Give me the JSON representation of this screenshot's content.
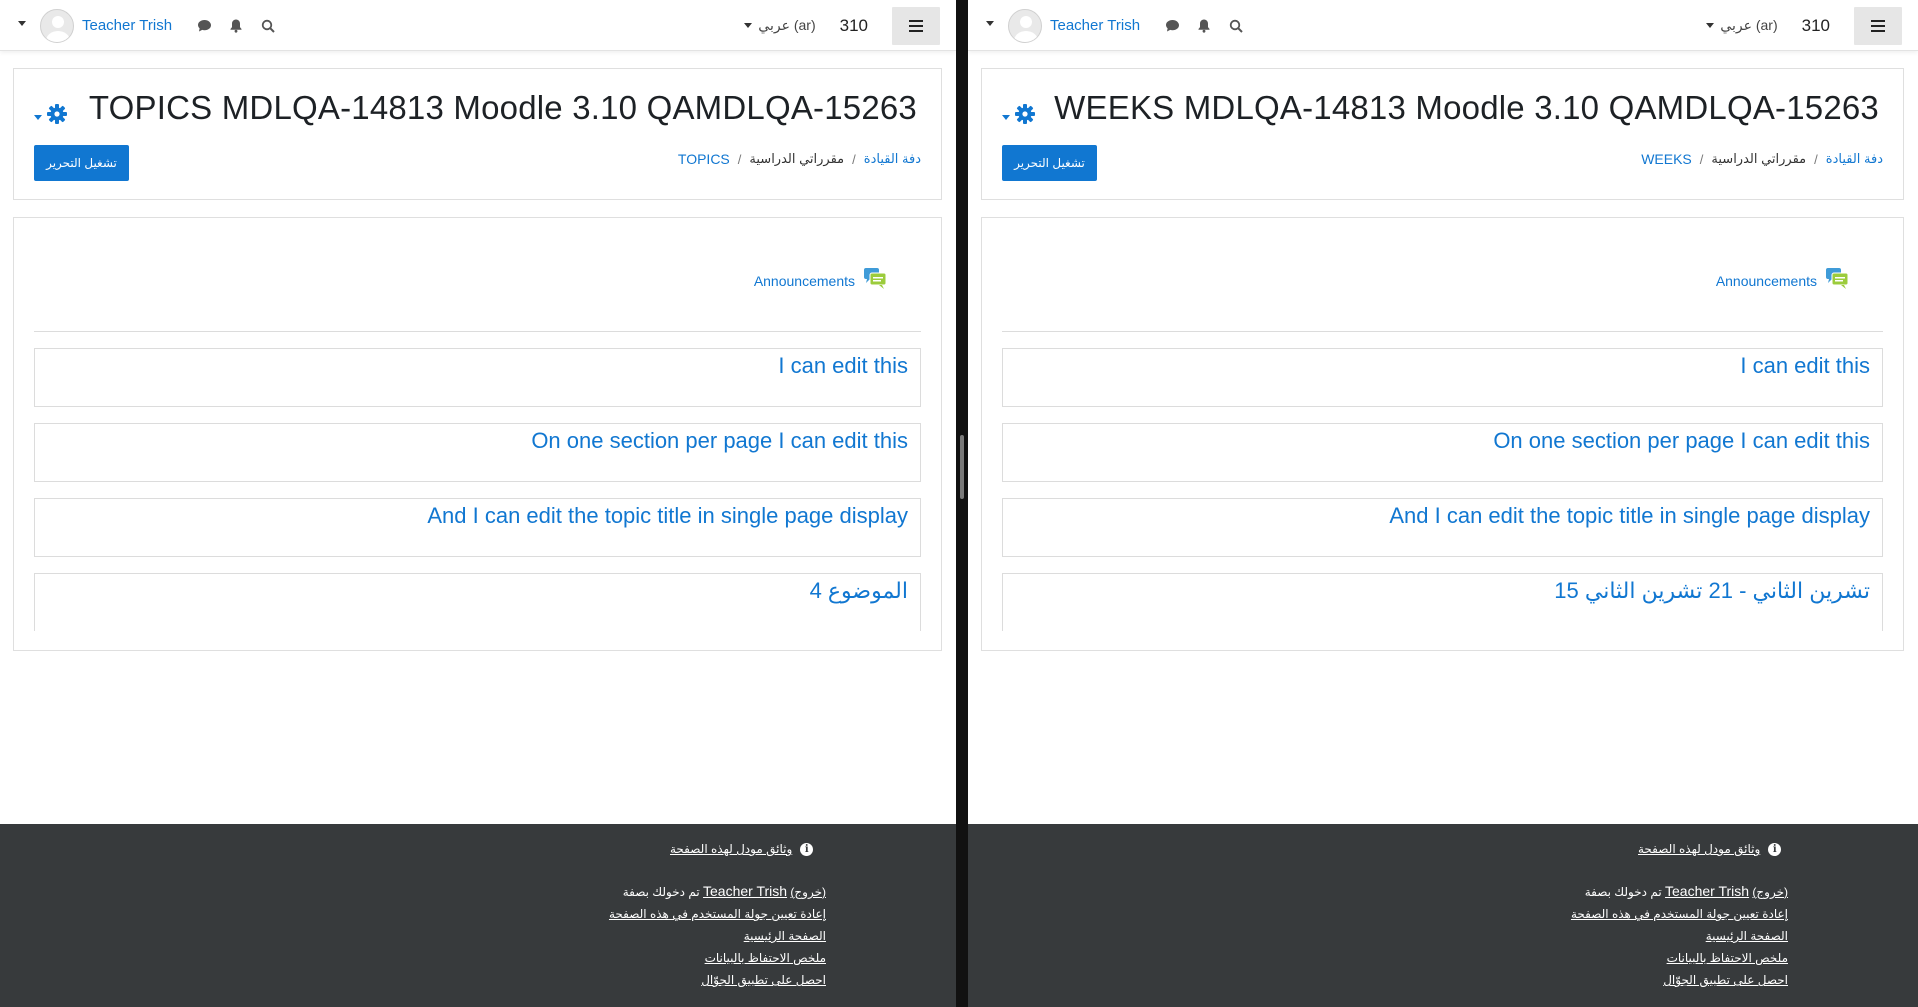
{
  "panes": {
    "left": {
      "navbar": {
        "user_name": "Teacher Trish",
        "lang_label": "عربي ‎(ar)‎",
        "points": "310"
      },
      "header": {
        "title": "TOPICS MDLQA-14813 Moodle 3.10 QAMDLQA-15263",
        "breadcrumb": {
          "home": "دفة القيادة",
          "courses": "مقرراتي الدراسية",
          "current": "TOPICS"
        },
        "edit_button": "تشغيل التحرير"
      },
      "content": {
        "announcements": "Announcements",
        "sections": [
          "I can edit this",
          "On one section per page I can edit this",
          "And I can edit the topic title in single page display",
          "الموضوع 4"
        ]
      },
      "footer": {
        "docs_link": "وثائق مودل لهذه الصفحة",
        "logged_in_prefix": "تم دخولك بصفة",
        "logged_in_user": "Teacher Trish",
        "logout": "(خروج)",
        "reset_tour": "إعادة تعيين جولة المستخدم في هذه الصفحة",
        "home": "الصفحة الرئيسية",
        "data_retention": "ملخص الاحتفاظ بالبيانات",
        "mobile_app": "احصل على تطبيق الجوّال"
      }
    },
    "right": {
      "navbar": {
        "user_name": "Teacher Trish",
        "lang_label": "عربي ‎(ar)‎",
        "points": "310"
      },
      "header": {
        "title": "WEEKS MDLQA-14813 Moodle 3.10 QAMDLQA-15263",
        "breadcrumb": {
          "home": "دفة القيادة",
          "courses": "مقرراتي الدراسية",
          "current": "WEEKS"
        },
        "edit_button": "تشغيل التحرير"
      },
      "content": {
        "announcements": "Announcements",
        "sections": [
          "I can edit this",
          "On one section per page I can edit this",
          "And I can edit the topic title in single page display",
          "15 تشرين الثاني - 21 تشرين الثاني"
        ]
      },
      "footer": {
        "docs_link": "وثائق مودل لهذه الصفحة",
        "logged_in_prefix": "تم دخولك بصفة",
        "logged_in_user": "Teacher Trish",
        "logout": "(خروج)",
        "reset_tour": "إعادة تعيين جولة المستخدم في هذه الصفحة",
        "home": "الصفحة الرئيسية",
        "data_retention": "ملخص الاحتفاظ بالبيانات",
        "mobile_app": "احصل على تطبيق الجوّال"
      }
    }
  },
  "icons": {
    "user_menu_caret": "chevron-down-icon",
    "messages": "chat-bubble-icon",
    "notifications": "bell-icon",
    "search": "search-icon",
    "menu": "hamburger-icon",
    "settings": "gear-icon",
    "forum": "forum-icon",
    "info": "info-icon"
  },
  "colors": {
    "link": "#1177d1",
    "primary_button": "#1177d1",
    "footer_bg": "#373a3c",
    "split_divider": "#111111"
  }
}
